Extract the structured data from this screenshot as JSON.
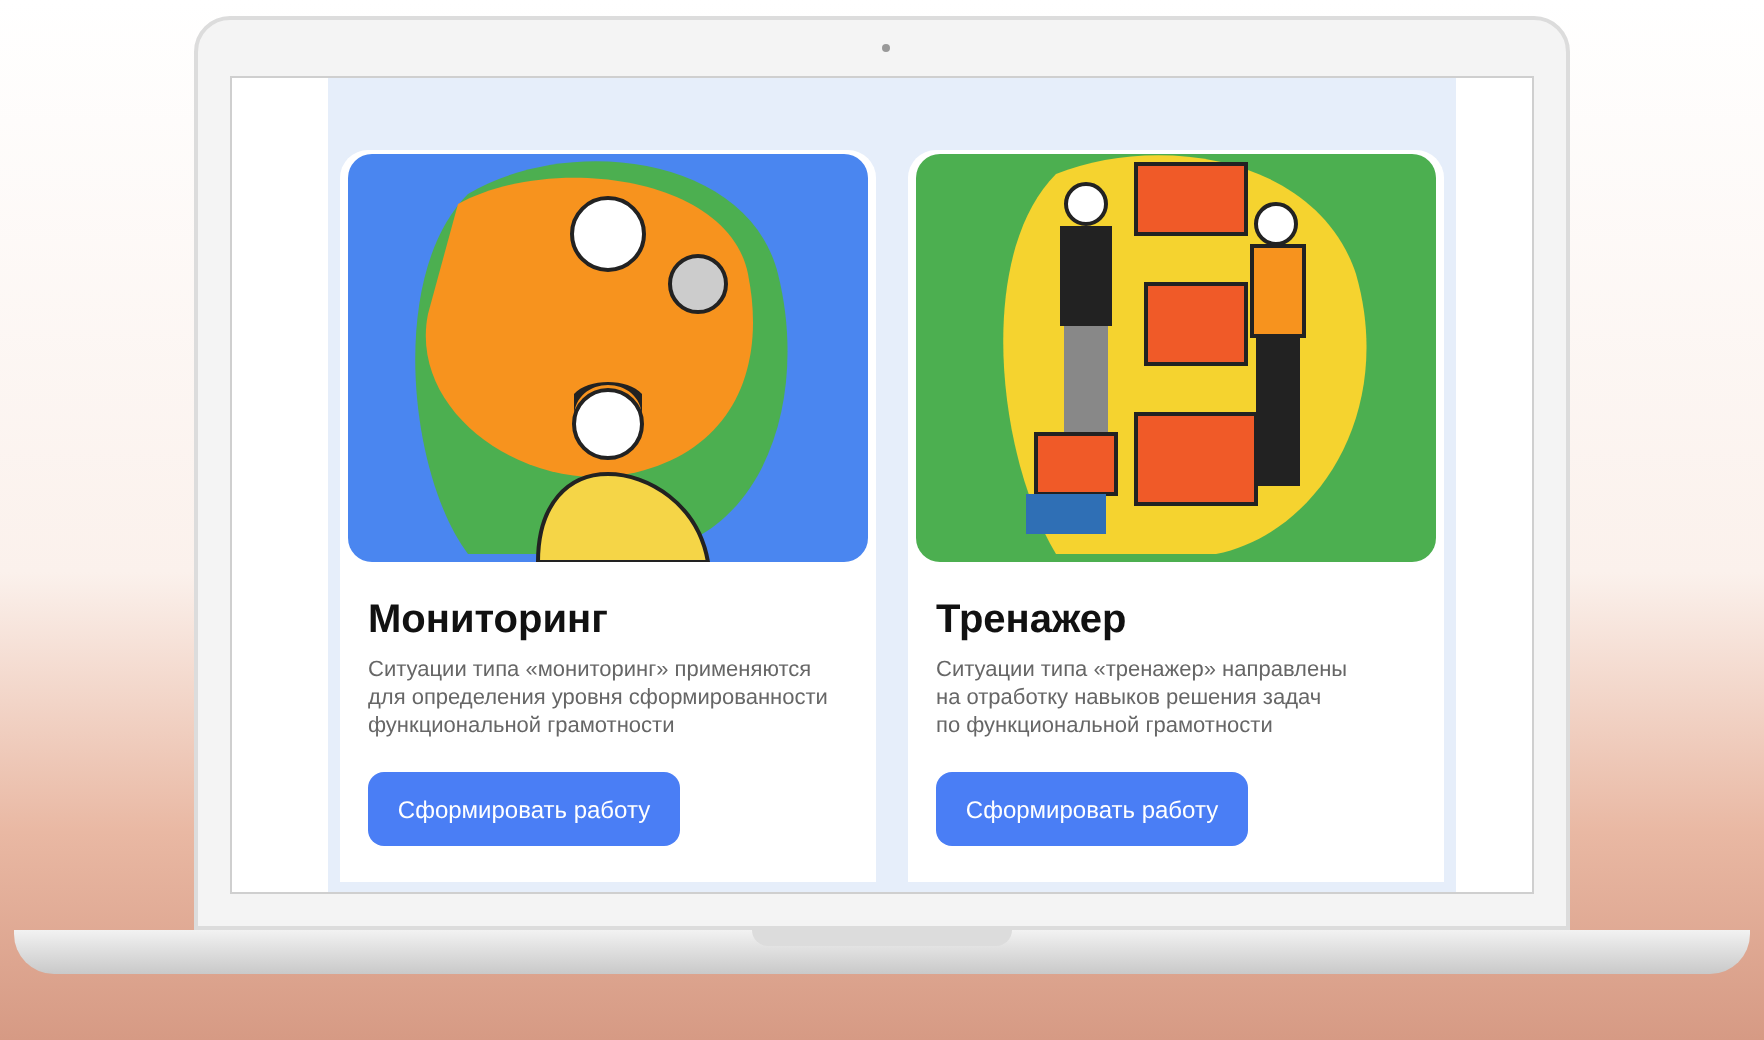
{
  "cards": [
    {
      "kind": "monitoring",
      "title": "Мониторинг",
      "description": "Ситуации типа «мониторинг» применяются\nдля определения уровня сформированности\nфункциональной грамотности",
      "button": "Сформировать работу"
    },
    {
      "kind": "trainer",
      "title": "Тренажер",
      "description": "Ситуации типа «тренажер» направлены\nна отработку навыков решения задач\nпо функциональной грамотности",
      "button": "Сформировать работу"
    }
  ]
}
